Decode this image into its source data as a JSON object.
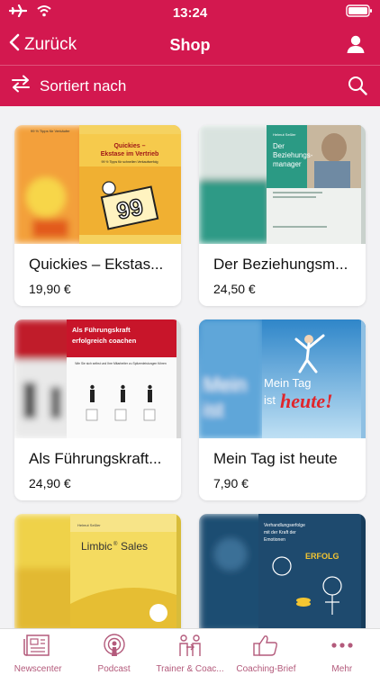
{
  "status_bar": {
    "time": "13:24"
  },
  "nav": {
    "back_label": "Zurück",
    "title": "Shop"
  },
  "sort": {
    "label": "Sortiert nach"
  },
  "colors": {
    "brand": "#d3184f",
    "tab_tint": "#b35a7b"
  },
  "products": [
    {
      "title": "Quickies – Ekstas...",
      "price": "19,90 €",
      "cover": {
        "title": "Quickies – Ekstase im Vertrieb",
        "subtitle": "99 ½ Tipps für schnellen Verkaufserfolg",
        "corner": "99 ½ Tipps für Verkäufer",
        "badge": "99"
      }
    },
    {
      "title": "Der Beziehungsm...",
      "price": "24,50 €",
      "cover": {
        "title": "Der Beziehungs-manager",
        "author": "Helmut Seßler"
      }
    },
    {
      "title": "Als Führungskraft...",
      "price": "24,90 €",
      "cover": {
        "title": "Als Führungskraft erfolgreich coachen",
        "subtitle": "Wie Sie sich selbst und Ihre Mitarbeiter zu Spitzenleistungen führen"
      }
    },
    {
      "title": "Mein Tag ist heute",
      "price": "7,90 €",
      "cover": {
        "title": "Mein Tag ist heute!"
      }
    },
    {
      "title": "",
      "price": "",
      "cover": {
        "title": "Limbic® Sales",
        "author": "Helmut Seßler"
      }
    },
    {
      "title": "",
      "price": "",
      "cover": {
        "title": "Verhandlungserfolge mit der Kraft der Emotionen",
        "badge": "ERFOLG"
      }
    }
  ],
  "tabs": [
    {
      "label": "Newscenter",
      "icon": "newspaper-icon"
    },
    {
      "label": "Podcast",
      "icon": "podcast-icon"
    },
    {
      "label": "Trainer & Coac...",
      "icon": "trainer-coach-icon"
    },
    {
      "label": "Coaching-Brief",
      "icon": "thumbs-up-icon"
    },
    {
      "label": "Mehr",
      "icon": "more-dots-icon"
    }
  ]
}
